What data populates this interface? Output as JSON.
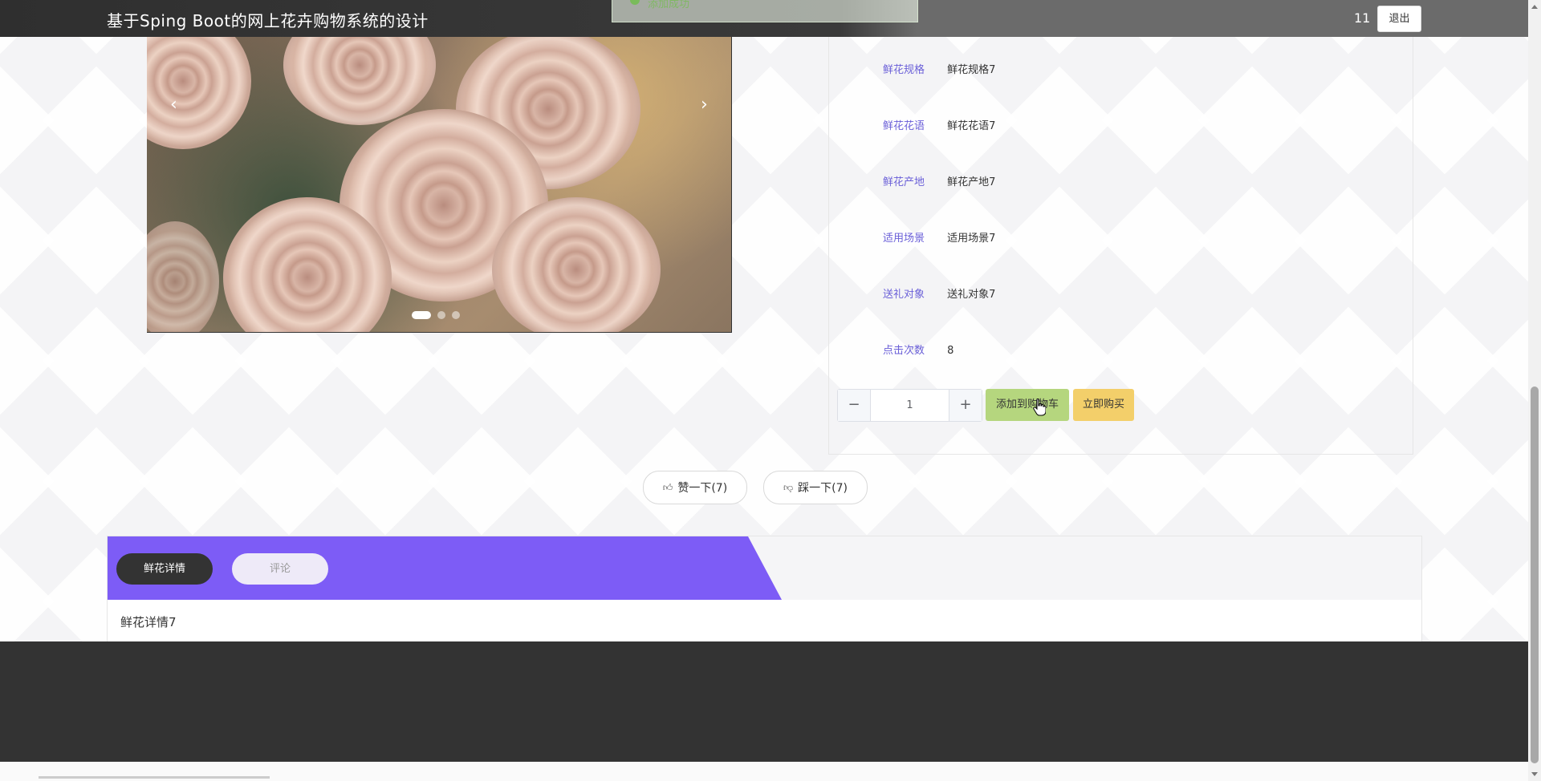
{
  "header": {
    "title": "基于Sping Boot的网上花卉购物系统的设计",
    "username": "11",
    "logout_label": "退出"
  },
  "toast": {
    "text": "添加成功"
  },
  "product": {
    "attributes": [
      {
        "label": "鲜花规格",
        "value": "鲜花规格7"
      },
      {
        "label": "鲜花花语",
        "value": "鲜花花语7"
      },
      {
        "label": "鲜花产地",
        "value": "鲜花产地7"
      },
      {
        "label": "适用场景",
        "value": "适用场景7"
      },
      {
        "label": "送礼对象",
        "value": "送礼对象7"
      },
      {
        "label": "点击次数",
        "value": "8"
      }
    ],
    "quantity": "1",
    "add_to_cart_label": "添加到购物车",
    "buy_now_label": "立即购买"
  },
  "carousel": {
    "prev_icon": "‹",
    "next_icon": "›",
    "active_index": 0,
    "count": 3
  },
  "votes": {
    "like_label": "赞一下(7)",
    "dislike_label": "踩一下(7)"
  },
  "tabs": {
    "items": [
      {
        "label": "鲜花详情"
      },
      {
        "label": "评论"
      }
    ],
    "content": "鲜花详情7"
  },
  "colors": {
    "accent": "#7d5cf6",
    "cart": "#b5d67e",
    "buy": "#f3cf6a",
    "label": "#6a5fd8",
    "header": "#333333"
  }
}
